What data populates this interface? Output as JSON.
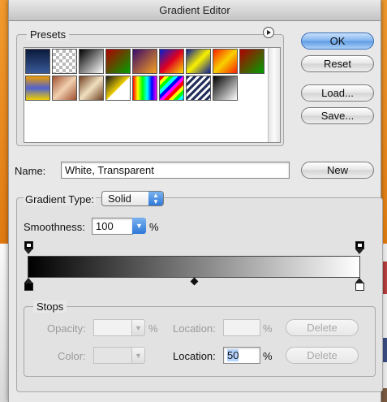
{
  "window": {
    "title": "Gradient Editor"
  },
  "presets": {
    "legend": "Presets",
    "swatches_row1": [
      "linear-gradient(#0a1a3a,#3a5a9a)",
      "repeating-conic-gradient(#bbb 0 25%, #fff 0 50%) 0 0/8px 8px",
      "linear-gradient(135deg,#000,#fff)",
      "linear-gradient(135deg,#b00000,#00a000)",
      "linear-gradient(135deg,#3a0a6a,#f8a020)",
      "linear-gradient(135deg,#0020d0,#e00020,#f8e000)",
      "linear-gradient(135deg,#0a1a9a,#f8f000,#0a1a9a)",
      "linear-gradient(135deg,#f82000,#f8d000,#f82000)",
      "linear-gradient(135deg,#b00000,#00a000)"
    ],
    "swatches_row2": [
      "linear-gradient(#f0a000,#5060d0,#f0d000)",
      "linear-gradient(135deg,#a05030,#f0d0b0,#a05030)",
      "linear-gradient(135deg,#704020,#f0e0c0,#704020)",
      "linear-gradient(135deg,#1a1a1a,#f0d000 50%,#fff 51%)",
      "linear-gradient(90deg,#f00,#ff0,#0f0,#0ff,#00f,#f0f)",
      "repeating-linear-gradient(135deg,#f00 0 4px,#ff0 4px 8px,#0f0 8px 12px,#0ff 12px 16px,#00f 16px 20px,#f0f 20px 24px)",
      "repeating-linear-gradient(135deg,#22305a 0 3px,#fff 3px 6px)",
      "linear-gradient(135deg,#000,#fff)"
    ]
  },
  "buttons": {
    "ok": "OK",
    "reset": "Reset",
    "load": "Load...",
    "save": "Save...",
    "new": "New"
  },
  "name": {
    "label": "Name:",
    "value": "White, Transparent"
  },
  "gradient_type": {
    "label": "Gradient Type:",
    "value": "Solid"
  },
  "smoothness": {
    "label": "Smoothness:",
    "value": "100",
    "unit": "%"
  },
  "stops": {
    "legend": "Stops",
    "opacity_label": "Opacity:",
    "opacity_value": "",
    "opacity_unit": "%",
    "opacity_location_label": "Location:",
    "opacity_location_value": "",
    "opacity_location_unit": "%",
    "delete1": "Delete",
    "color_label": "Color:",
    "color_location_label": "Location:",
    "color_location_value": "50",
    "color_location_unit": "%",
    "delete2": "Delete"
  },
  "colors": {
    "accent": "#2f78d8",
    "desktop": "#f29a2e"
  }
}
